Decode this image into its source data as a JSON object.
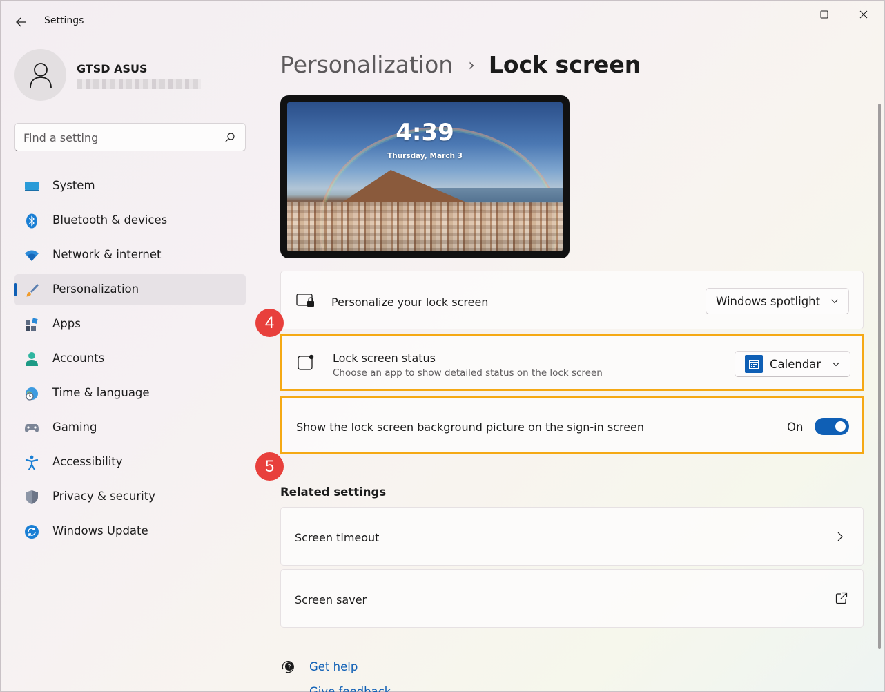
{
  "window": {
    "title": "Settings",
    "controls": {
      "minimize": "minimize",
      "maximize": "maximize",
      "close": "close"
    }
  },
  "profile": {
    "name": "GTSD ASUS",
    "email_redacted": true
  },
  "search": {
    "placeholder": "Find a setting"
  },
  "sidebar": {
    "items": [
      {
        "label": "System",
        "icon": "system-icon"
      },
      {
        "label": "Bluetooth & devices",
        "icon": "bluetooth-icon"
      },
      {
        "label": "Network & internet",
        "icon": "wifi-icon"
      },
      {
        "label": "Personalization",
        "icon": "brush-icon",
        "active": true
      },
      {
        "label": "Apps",
        "icon": "apps-icon"
      },
      {
        "label": "Accounts",
        "icon": "accounts-icon"
      },
      {
        "label": "Time & language",
        "icon": "globe-clock-icon"
      },
      {
        "label": "Gaming",
        "icon": "gamepad-icon"
      },
      {
        "label": "Accessibility",
        "icon": "accessibility-icon"
      },
      {
        "label": "Privacy & security",
        "icon": "shield-icon"
      },
      {
        "label": "Windows Update",
        "icon": "update-icon"
      }
    ]
  },
  "breadcrumb": {
    "parent": "Personalization",
    "separator": "›",
    "current": "Lock screen"
  },
  "preview": {
    "time": "4:39",
    "date": "Thursday, March 3"
  },
  "settings": {
    "personalize": {
      "title": "Personalize your lock screen",
      "value": "Windows spotlight"
    },
    "status": {
      "title": "Lock screen status",
      "subtitle": "Choose an app to show detailed status on the lock screen",
      "value": "Calendar"
    },
    "signin": {
      "title": "Show the lock screen background picture on the sign-in screen",
      "state_label": "On",
      "on": true
    }
  },
  "related": {
    "title": "Related settings",
    "items": [
      {
        "label": "Screen timeout"
      },
      {
        "label": "Screen saver"
      }
    ]
  },
  "help": {
    "get_help": "Get help",
    "give_feedback": "Give feedback"
  },
  "annotations": {
    "badge_4": "4",
    "badge_5": "5"
  },
  "colors": {
    "accent": "#0f5fb5",
    "highlight": "#f5a914",
    "badge": "#e8403c"
  }
}
